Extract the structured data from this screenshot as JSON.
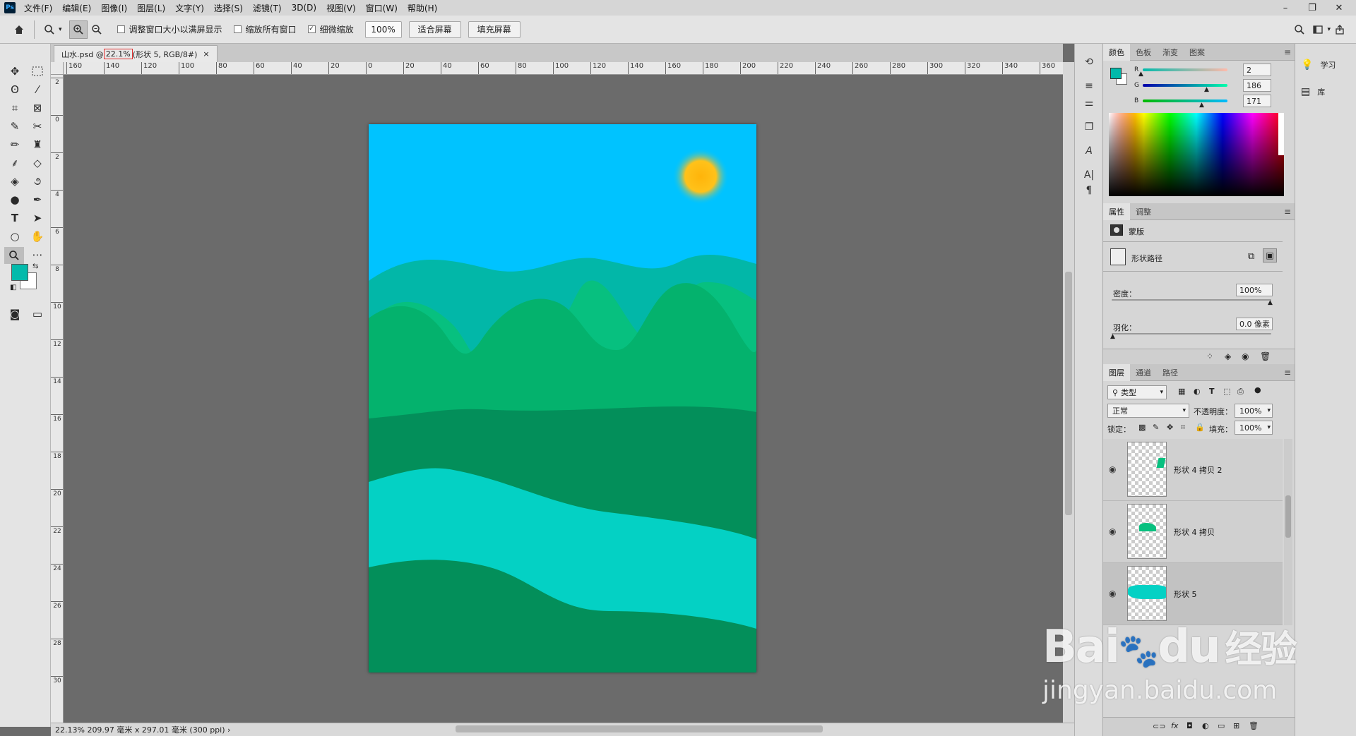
{
  "app": {
    "logo": "Ps"
  },
  "menu": [
    "文件(F)",
    "编辑(E)",
    "图像(I)",
    "图层(L)",
    "文字(Y)",
    "选择(S)",
    "滤镜(T)",
    "3D(D)",
    "视图(V)",
    "窗口(W)",
    "帮助(H)"
  ],
  "window_controls": {
    "minimize": "–",
    "restore": "❐",
    "close": "✕"
  },
  "options": {
    "resize_windows": "调整窗口大小以满屏显示",
    "zoom_all": "缩放所有窗口",
    "scrubby_zoom": "细微缩放",
    "scrubby_checked": "✓",
    "zoom_value": "100%",
    "fit_screen": "适合屏幕",
    "fill_screen": "填充屏幕"
  },
  "document": {
    "tab_name": "山水.psd @ ",
    "zoom": "22.1%",
    "tab_rest": "(形状 5, RGB/8#)",
    "close": "×"
  },
  "rulers": {
    "h": [
      "160",
      "140",
      "120",
      "100",
      "80",
      "60",
      "40",
      "20",
      "0",
      "20",
      "40",
      "60",
      "80",
      "100",
      "120",
      "140",
      "160",
      "180",
      "200",
      "220",
      "240",
      "260",
      "280",
      "300",
      "320",
      "340",
      "360"
    ],
    "v": [
      "2",
      "0",
      "2",
      "4",
      "6",
      "8",
      "10",
      "12",
      "14",
      "16",
      "18",
      "20",
      "22",
      "24",
      "26",
      "28",
      "30"
    ]
  },
  "status": {
    "text": "22.13%   209.97 毫米 x 297.01 毫米 (300 ppi)  ›"
  },
  "color_panel": {
    "tabs": [
      "颜色",
      "色板",
      "渐变",
      "图案"
    ],
    "r_label": "R",
    "g_label": "G",
    "b_label": "B",
    "r": "2",
    "g": "186",
    "b": "171",
    "fg_color": "#02baab"
  },
  "properties_panel": {
    "tabs": [
      "属性",
      "调整"
    ],
    "mask_label": "蒙版",
    "path_label": "形状路径",
    "density_label": "密度：",
    "density_value": "100%",
    "feather_label": "羽化：",
    "feather_value": "0.0 像素"
  },
  "layers_panel": {
    "tabs": [
      "图层",
      "通道",
      "路径"
    ],
    "filter_label": "类型",
    "blend_mode": "正常",
    "opacity_label": "不透明度：",
    "opacity_value": "100%",
    "lock_label": "锁定：",
    "fill_label": "填充：",
    "fill_value": "100%",
    "layers": [
      {
        "name": "形状 4 拷贝 2"
      },
      {
        "name": "形状 4 拷贝"
      },
      {
        "name": "形状 5"
      }
    ]
  },
  "right_panel": {
    "learn": "学习",
    "library": "库"
  },
  "watermark": {
    "brand": "Bai",
    "brand2": "du",
    "product": "经验",
    "url": "jingyan.baidu.com"
  }
}
